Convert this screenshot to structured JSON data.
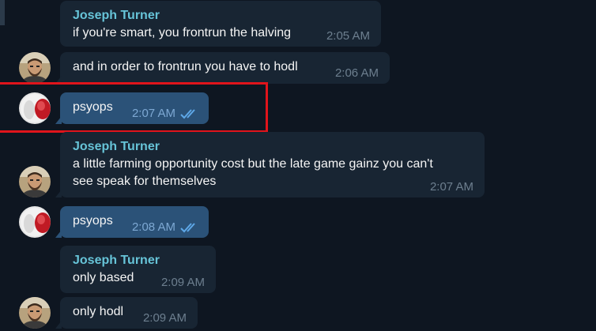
{
  "messages": [
    {
      "sender": "Joseph Turner",
      "text": "if you're smart, you frontrun the halving",
      "time": "2:05 AM",
      "direction": "in"
    },
    {
      "sender": "",
      "text": "and in order to frontrun you have to hodl",
      "time": "2:06 AM",
      "direction": "in"
    },
    {
      "sender": "",
      "text": "psyops",
      "time": "2:07 AM",
      "direction": "out",
      "status": "read"
    },
    {
      "sender": "Joseph Turner",
      "text": "a little farming opportunity cost but the late game gainz you can't\nsee speak for themselves",
      "time": "2:07 AM",
      "direction": "in"
    },
    {
      "sender": "",
      "text": "psyops",
      "time": "2:08 AM",
      "direction": "out",
      "status": "read"
    },
    {
      "sender": "Joseph Turner",
      "text": "only based",
      "time": "2:09 AM",
      "direction": "in"
    },
    {
      "sender": "",
      "text": "only hodl",
      "time": "2:09 AM",
      "direction": "in"
    }
  ],
  "colors": {
    "background": "#0e1621",
    "incoming_bubble": "#182533",
    "outgoing_bubble": "#2b5278",
    "sender_name": "#67c4d8",
    "timestamp": "#6d7f8f",
    "read_ticks": "#5ea8e8",
    "highlight_box": "#e0141b"
  },
  "icons": {
    "read_status": "double-check-icon",
    "incoming_avatar": "bearded-man-avatar",
    "outgoing_avatar": "red-pill-avatar"
  }
}
